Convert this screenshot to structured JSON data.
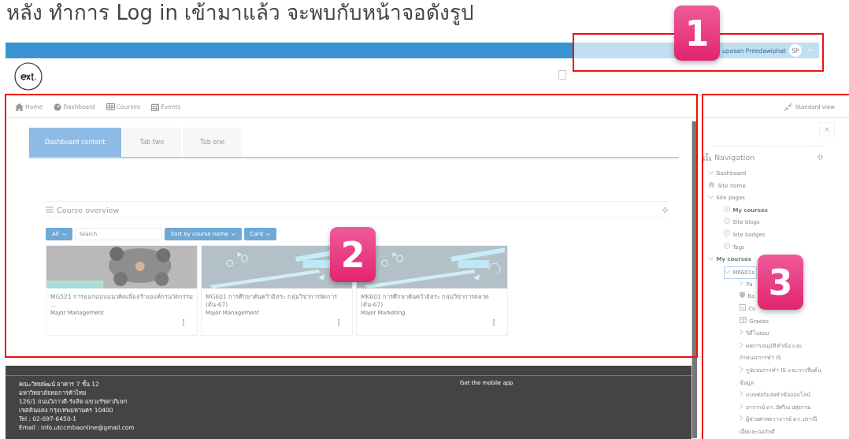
{
  "heading": "หลัง ทำการ Log in เข้ามาแล้ว จะพบกับหน้าจอดังรูป",
  "topbar": {
    "user_name": "upasan Preedawiphat",
    "avatar": "SP"
  },
  "nav": [
    {
      "label": "Home",
      "kind": "home"
    },
    {
      "label": "Dashboard",
      "kind": "gauge"
    },
    {
      "label": "Courses",
      "kind": "grid"
    },
    {
      "label": "Events",
      "kind": "calendar"
    }
  ],
  "standard_view": "Standard view",
  "close": "×",
  "tabs": [
    {
      "label": "Dashboard content",
      "selected": true
    },
    {
      "label": "Tab two",
      "selected": false
    },
    {
      "label": "Tab one",
      "selected": false
    }
  ],
  "course_overview": {
    "title": "Course overview",
    "filter": "All",
    "search_placeholder": "Search",
    "sort": "Sort by course name",
    "view": "Card",
    "courses": [
      {
        "title": "MG521 การออกแบบแนวคิดเพื่อสร้างองค์กรนวัตกรรม ...",
        "category": "Major Management"
      },
      {
        "title": "MG601 การศึกษาค้นคว้าอิสระ กลุ่มวิชาการจัดการ (ต้น-67)",
        "category": "Major Management"
      },
      {
        "title": "MK601 การศึกษาค้นคว้าอิสระ กลุ่มวิชาการตลาด (ต้น-67)",
        "category": "Major Marketing"
      }
    ]
  },
  "sidebar": {
    "title": "Navigation",
    "tree": [
      {
        "label": "Dashboard",
        "kind": "toggle",
        "expanded": true,
        "selected": false,
        "bold": false
      },
      {
        "label": "Site home",
        "kind": "home",
        "selected": false,
        "bold": false
      },
      {
        "label": "Site pages",
        "kind": "toggle",
        "expanded": true,
        "selected": false,
        "bold": false,
        "children": [
          {
            "label": "My courses",
            "kind": "page",
            "selected": false,
            "bold": true
          },
          {
            "label": "Site blogs",
            "kind": "page",
            "selected": false,
            "bold": false
          },
          {
            "label": "Site badges",
            "kind": "page",
            "selected": false,
            "bold": false
          },
          {
            "label": "Tags",
            "kind": "page",
            "selected": false,
            "bold": false
          }
        ]
      },
      {
        "label": "My courses",
        "kind": "toggle",
        "expanded": true,
        "selected": false,
        "bold": true,
        "children": [
          {
            "label": "MK601ธ",
            "kind": "toggle",
            "expanded": true,
            "selected": true,
            "bold": false,
            "children": [
              {
                "label": "Pa",
                "kind": "toggle",
                "expanded": false,
                "selected": false,
                "bold": false
              },
              {
                "label": "Ba",
                "kind": "shield",
                "selected": false,
                "bold": false
              },
              {
                "label": "Co",
                "kind": "check",
                "selected": false,
                "bold": false
              },
              {
                "label": "Grades",
                "kind": "table",
                "selected": false,
                "bold": false
              },
              {
                "label": "วิดีโอสอบ",
                "kind": "toggle",
                "expanded": false,
                "selected": false,
                "bold": false
              },
              {
                "label": "ผลการอนุมัติหัวข้อ และกำหนดการทำ IS",
                "kind": "toggle",
                "expanded": false,
                "selected": false,
                "bold": false
              },
              {
                "label": "รูปแบบการทำ IS และการสืบค้นข้อมูล",
                "kind": "toggle",
                "expanded": false,
                "selected": false,
                "bold": false
              },
              {
                "label": "แบบฟอร์มส่งหัวข้อออนไลน์",
                "kind": "toggle",
                "expanded": false,
                "selected": false,
                "bold": false
              },
              {
                "label": "อาจารย์ ดร.อัศวิณ ปสุธรรม",
                "kind": "toggle",
                "expanded": false,
                "selected": false,
                "bold": false
              },
              {
                "label": "ผู้ช่วยศาสตราจารย์ ดร.ปราณี เอี่ยมละออภักดี",
                "kind": "toggle",
                "expanded": false,
                "selected": false,
                "bold": false
              }
            ]
          }
        ]
      }
    ]
  },
  "footer": {
    "address_lines": [
      "คณะวิทยพัฒน์ อาคาร 7 ชั้น 12",
      "มหาวิทยาลัยหอการค้าไทย",
      "126/1 ถนนวิภาวดี-รังสิต แขวงรัชดาภิเษก",
      "เขตดินแดง กรุงเทพมหานคร 10400",
      "Tel : 02-697-6450-1",
      "Email : info.utccmbaonline@gmail.com"
    ],
    "mobile_app": "Get the mobile app"
  },
  "callouts": [
    {
      "number": "1"
    },
    {
      "number": "2"
    },
    {
      "number": "3"
    }
  ]
}
